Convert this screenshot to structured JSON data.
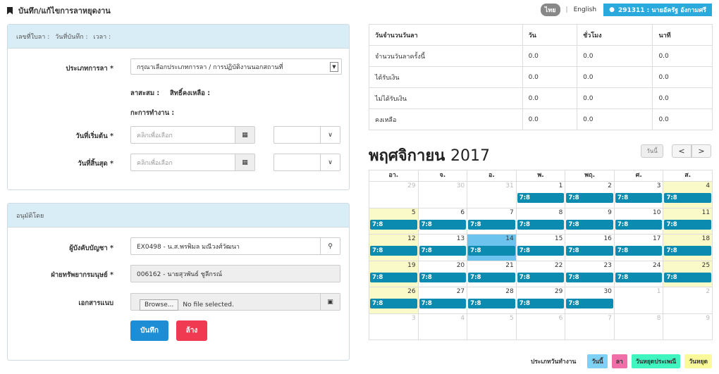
{
  "header": {
    "title": "บันทึก/แก้ไขการลาหยุดงาน",
    "lang_th": "ไทย",
    "lang_en": "English",
    "user": "291311 : นายอัครัฐ อังกามศรี"
  },
  "form": {
    "meta": {
      "leave_no": "เลขที่ใบลา :",
      "record_date": "วันที่บันทึก :",
      "time": "เวลา :"
    },
    "leave_type_label": "ประเภทการลา *",
    "leave_type_value": "กรุณาเลือกประเภทการลา / การปฏิบัติงานนอกสถานที่",
    "accumulated": "ลาสะสม :",
    "remaining": "สิทธิ์คงเหลือ :",
    "work_schedule": "กะการทำงาน :",
    "start_label": "วันที่เริ่มต้น *",
    "end_label": "วันที่สิ้นสุด *",
    "date_placeholder": "คลิกเพื่อเลือก"
  },
  "approval": {
    "title": "อนุมัติโดย",
    "supervisor_label": "ผู้บังคับบัญชา *",
    "supervisor_value": "EX0498 - น.ส.พรพิมล มณีวงศ์วัฒนา",
    "hr_label": "ฝ่ายทรัพยากรมนุษย์ *",
    "hr_value": "006162 - นายสุวพันธ์ ชูลีกรณ์",
    "attach_label": "เอกสารแนบ",
    "browse": "Browse...",
    "no_file": "No file selected.",
    "save": "บันทึก",
    "clear": "ล้าง"
  },
  "summary": {
    "headers": [
      "วันจำนวนวันลา",
      "วัน",
      "ชั่วโมง",
      "นาที"
    ],
    "rows": [
      [
        "จำนวนวันลาครั้งนี้",
        "0.0",
        "0.0",
        "0.0"
      ],
      [
        "ได้รับเงิน",
        "0.0",
        "0.0",
        "0.0"
      ],
      [
        "ไม่ได้รับเงิน",
        "0.0",
        "0.0",
        "0.0"
      ],
      [
        "คงเหลือ",
        "0.0",
        "0.0",
        "0.0"
      ]
    ]
  },
  "calendar": {
    "month": "พฤศจิกายน",
    "year": "2017",
    "today": "วันนี้",
    "prev": "<",
    "next": ">",
    "dow": [
      "อา.",
      "จ.",
      "อ.",
      "พ.",
      "พฤ.",
      "ศ.",
      "ส."
    ],
    "event": "7:8",
    "weeks": [
      [
        29,
        30,
        31,
        1,
        2,
        3,
        4
      ],
      [
        5,
        6,
        7,
        8,
        9,
        10,
        11
      ],
      [
        12,
        13,
        14,
        15,
        16,
        17,
        18
      ],
      [
        19,
        20,
        21,
        22,
        23,
        24,
        25
      ],
      [
        26,
        27,
        28,
        29,
        30,
        1,
        2
      ],
      [
        3,
        4,
        5,
        6,
        7,
        8,
        9
      ]
    ]
  },
  "legend": {
    "label": "ประเภทวันทำงาน",
    "items": [
      {
        "text": "วันนี้",
        "color": "#7fd0f5"
      },
      {
        "text": "ลา",
        "color": "#f06fa8"
      },
      {
        "text": "วันหยุดประเพณี",
        "color": "#3ff5c0"
      },
      {
        "text": "วันหยุด",
        "color": "#fafa9a"
      }
    ]
  }
}
